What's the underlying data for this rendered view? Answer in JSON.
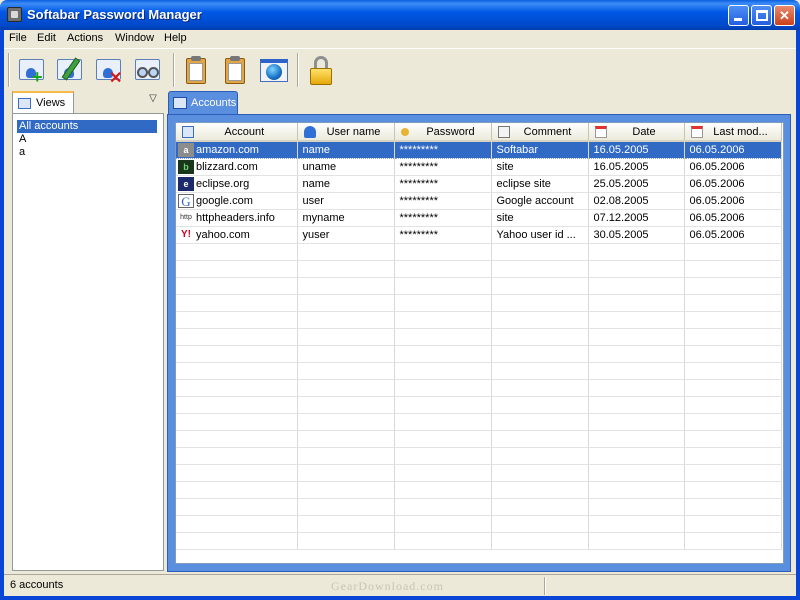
{
  "window": {
    "title": "Softabar Password Manager"
  },
  "menu": [
    "File",
    "Edit",
    "Actions",
    "Window",
    "Help"
  ],
  "toolbar": {
    "icons": [
      "add-account-icon",
      "edit-account-icon",
      "delete-account-icon",
      "find-icon",
      "copy-username-icon",
      "copy-password-icon",
      "open-url-icon",
      "lock-icon"
    ]
  },
  "views": {
    "tab_label": "Views",
    "items": [
      "All accounts",
      "A",
      "a"
    ],
    "selected_index": 0
  },
  "accounts": {
    "tab_label": "Accounts",
    "columns": [
      "Account",
      "User name",
      "Password",
      "Comment",
      "Date",
      "Last mod..."
    ],
    "rows": [
      {
        "account": "amazon.com",
        "username": "name",
        "password": "*********",
        "comment": "Softabar",
        "date": "16.05.2005",
        "lastmod": "06.05.2006",
        "icon": "amazon-favicon",
        "glyph": "a",
        "selected": true
      },
      {
        "account": "blizzard.com",
        "username": "uname",
        "password": "*********",
        "comment": "site",
        "date": "16.05.2005",
        "lastmod": "06.05.2006",
        "icon": "blizzard-favicon",
        "glyph": "b",
        "selected": false
      },
      {
        "account": "eclipse.org",
        "username": "name",
        "password": "*********",
        "comment": "eclipse site",
        "date": "25.05.2005",
        "lastmod": "06.05.2006",
        "icon": "eclipse-favicon",
        "glyph": "e",
        "selected": false
      },
      {
        "account": "google.com",
        "username": "user",
        "password": "*********",
        "comment": "Google account",
        "date": "02.08.2005",
        "lastmod": "06.05.2006",
        "icon": "google-favicon",
        "glyph": "G",
        "selected": false
      },
      {
        "account": "httpheaders.info",
        "username": "myname",
        "password": "*********",
        "comment": "site",
        "date": "07.12.2005",
        "lastmod": "06.05.2006",
        "icon": "httpheaders-favicon",
        "glyph": "http",
        "selected": false
      },
      {
        "account": "yahoo.com",
        "username": "yuser",
        "password": "*********",
        "comment": "Yahoo user id ...",
        "date": "30.05.2005",
        "lastmod": "06.05.2006",
        "icon": "yahoo-favicon",
        "glyph": "Y!",
        "selected": false
      }
    ]
  },
  "status": {
    "count_text": "6 accounts",
    "watermark": "GearDownload.com"
  },
  "colors": {
    "titlebar": "#0058e6",
    "selection": "#316ac5",
    "panel_border": "#5a8fe0"
  }
}
